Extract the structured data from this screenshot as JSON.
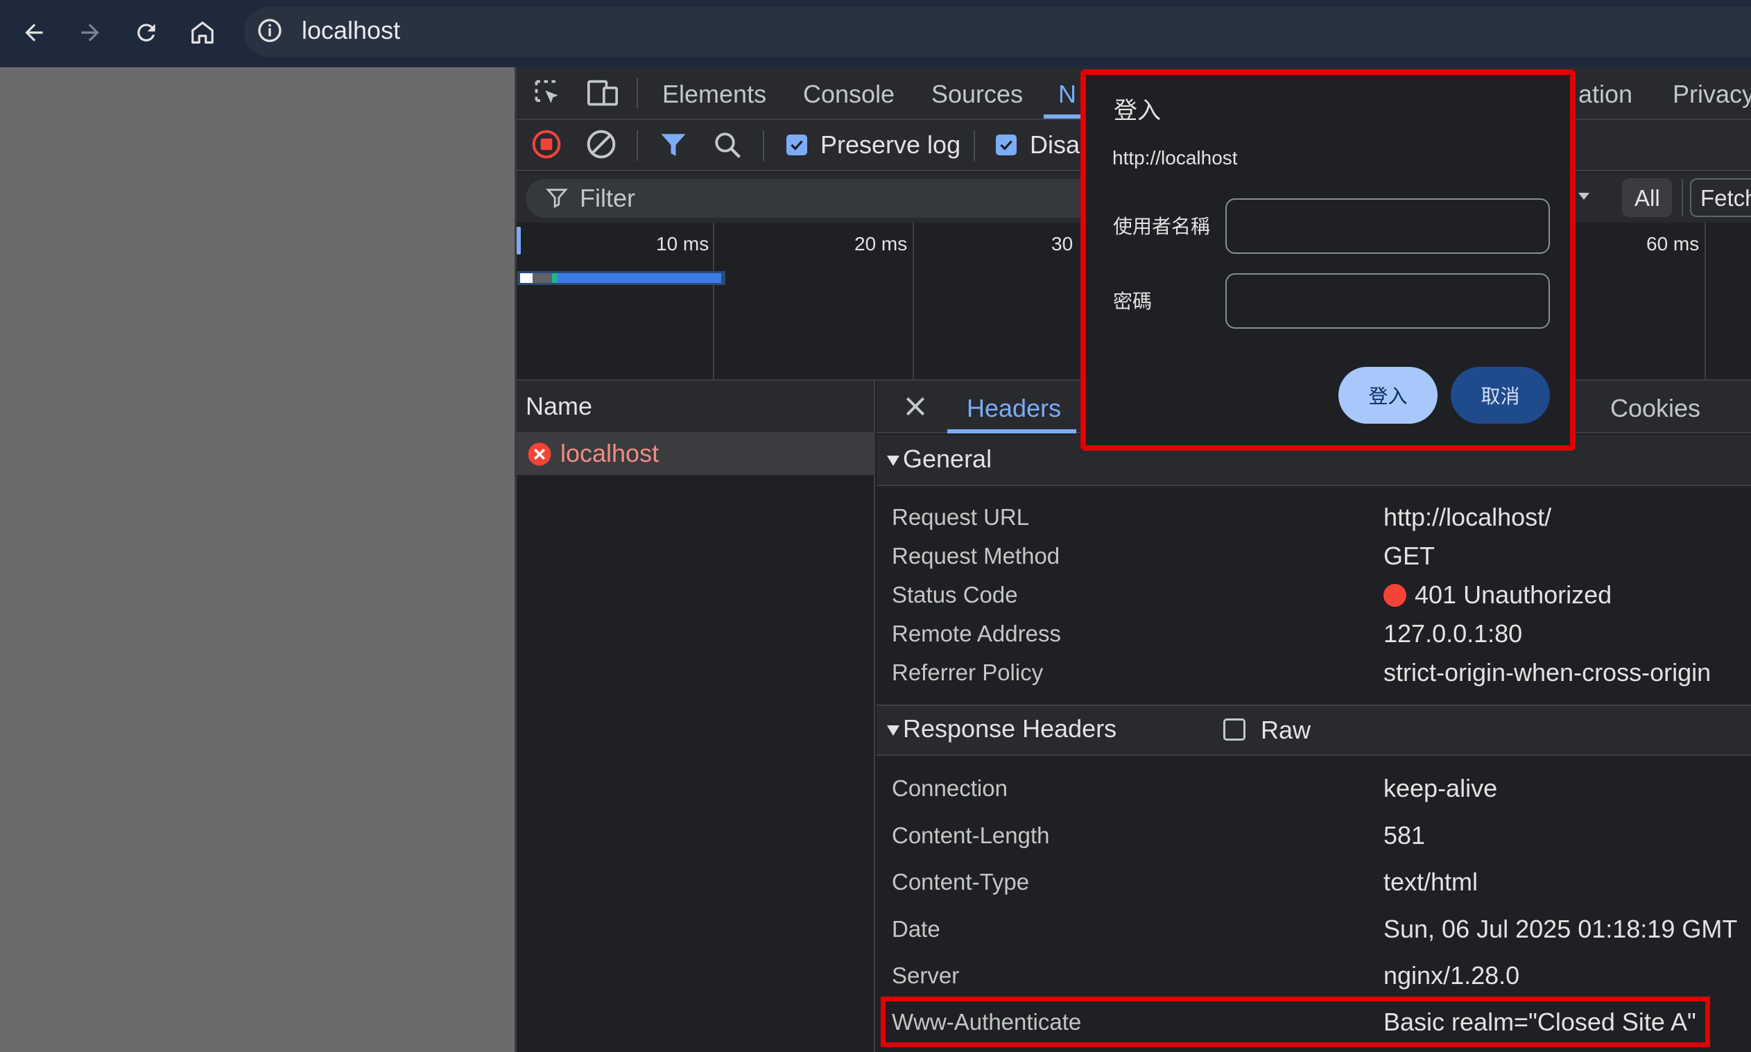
{
  "browser": {
    "url": "localhost"
  },
  "devtools": {
    "tabs": [
      "Elements",
      "Console",
      "Sources",
      "N",
      "ation",
      "Privacy"
    ],
    "toolbar": {
      "preserve_log": "Preserve log",
      "disable_cache": "Disa"
    },
    "filter": {
      "placeholder": "Filter",
      "type_all": "All",
      "type_fetch": "Fetch"
    },
    "timeline_labels": [
      "10 ms",
      "20 ms",
      "30",
      "60 ms"
    ],
    "name_header": "Name",
    "request_name": "localhost",
    "detail_tabs": {
      "headers": "Headers",
      "cookies": "Cookies"
    },
    "general": {
      "title": "General",
      "rows": [
        {
          "key": "Request URL",
          "value": "http://localhost/"
        },
        {
          "key": "Request Method",
          "value": "GET"
        },
        {
          "key": "Status Code",
          "value": "401 Unauthorized"
        },
        {
          "key": "Remote Address",
          "value": "127.0.0.1:80"
        },
        {
          "key": "Referrer Policy",
          "value": "strict-origin-when-cross-origin"
        }
      ]
    },
    "response_headers": {
      "title": "Response Headers",
      "raw_label": "Raw",
      "rows": [
        {
          "key": "Connection",
          "value": "keep-alive"
        },
        {
          "key": "Content-Length",
          "value": "581"
        },
        {
          "key": "Content-Type",
          "value": "text/html"
        },
        {
          "key": "Date",
          "value": "Sun, 06 Jul 2025 01:18:19 GMT"
        },
        {
          "key": "Server",
          "value": "nginx/1.28.0"
        },
        {
          "key": "Www-Authenticate",
          "value": "Basic realm=\"Closed Site A\""
        }
      ]
    }
  },
  "dialog": {
    "title": "登入",
    "origin": "http://localhost",
    "username_label": "使用者名稱",
    "password_label": "密碼",
    "login_button": "登入",
    "cancel_button": "取消"
  },
  "colors": {
    "highlight": "#e00000",
    "accent": "#7cacf8",
    "error": "#f44336"
  }
}
